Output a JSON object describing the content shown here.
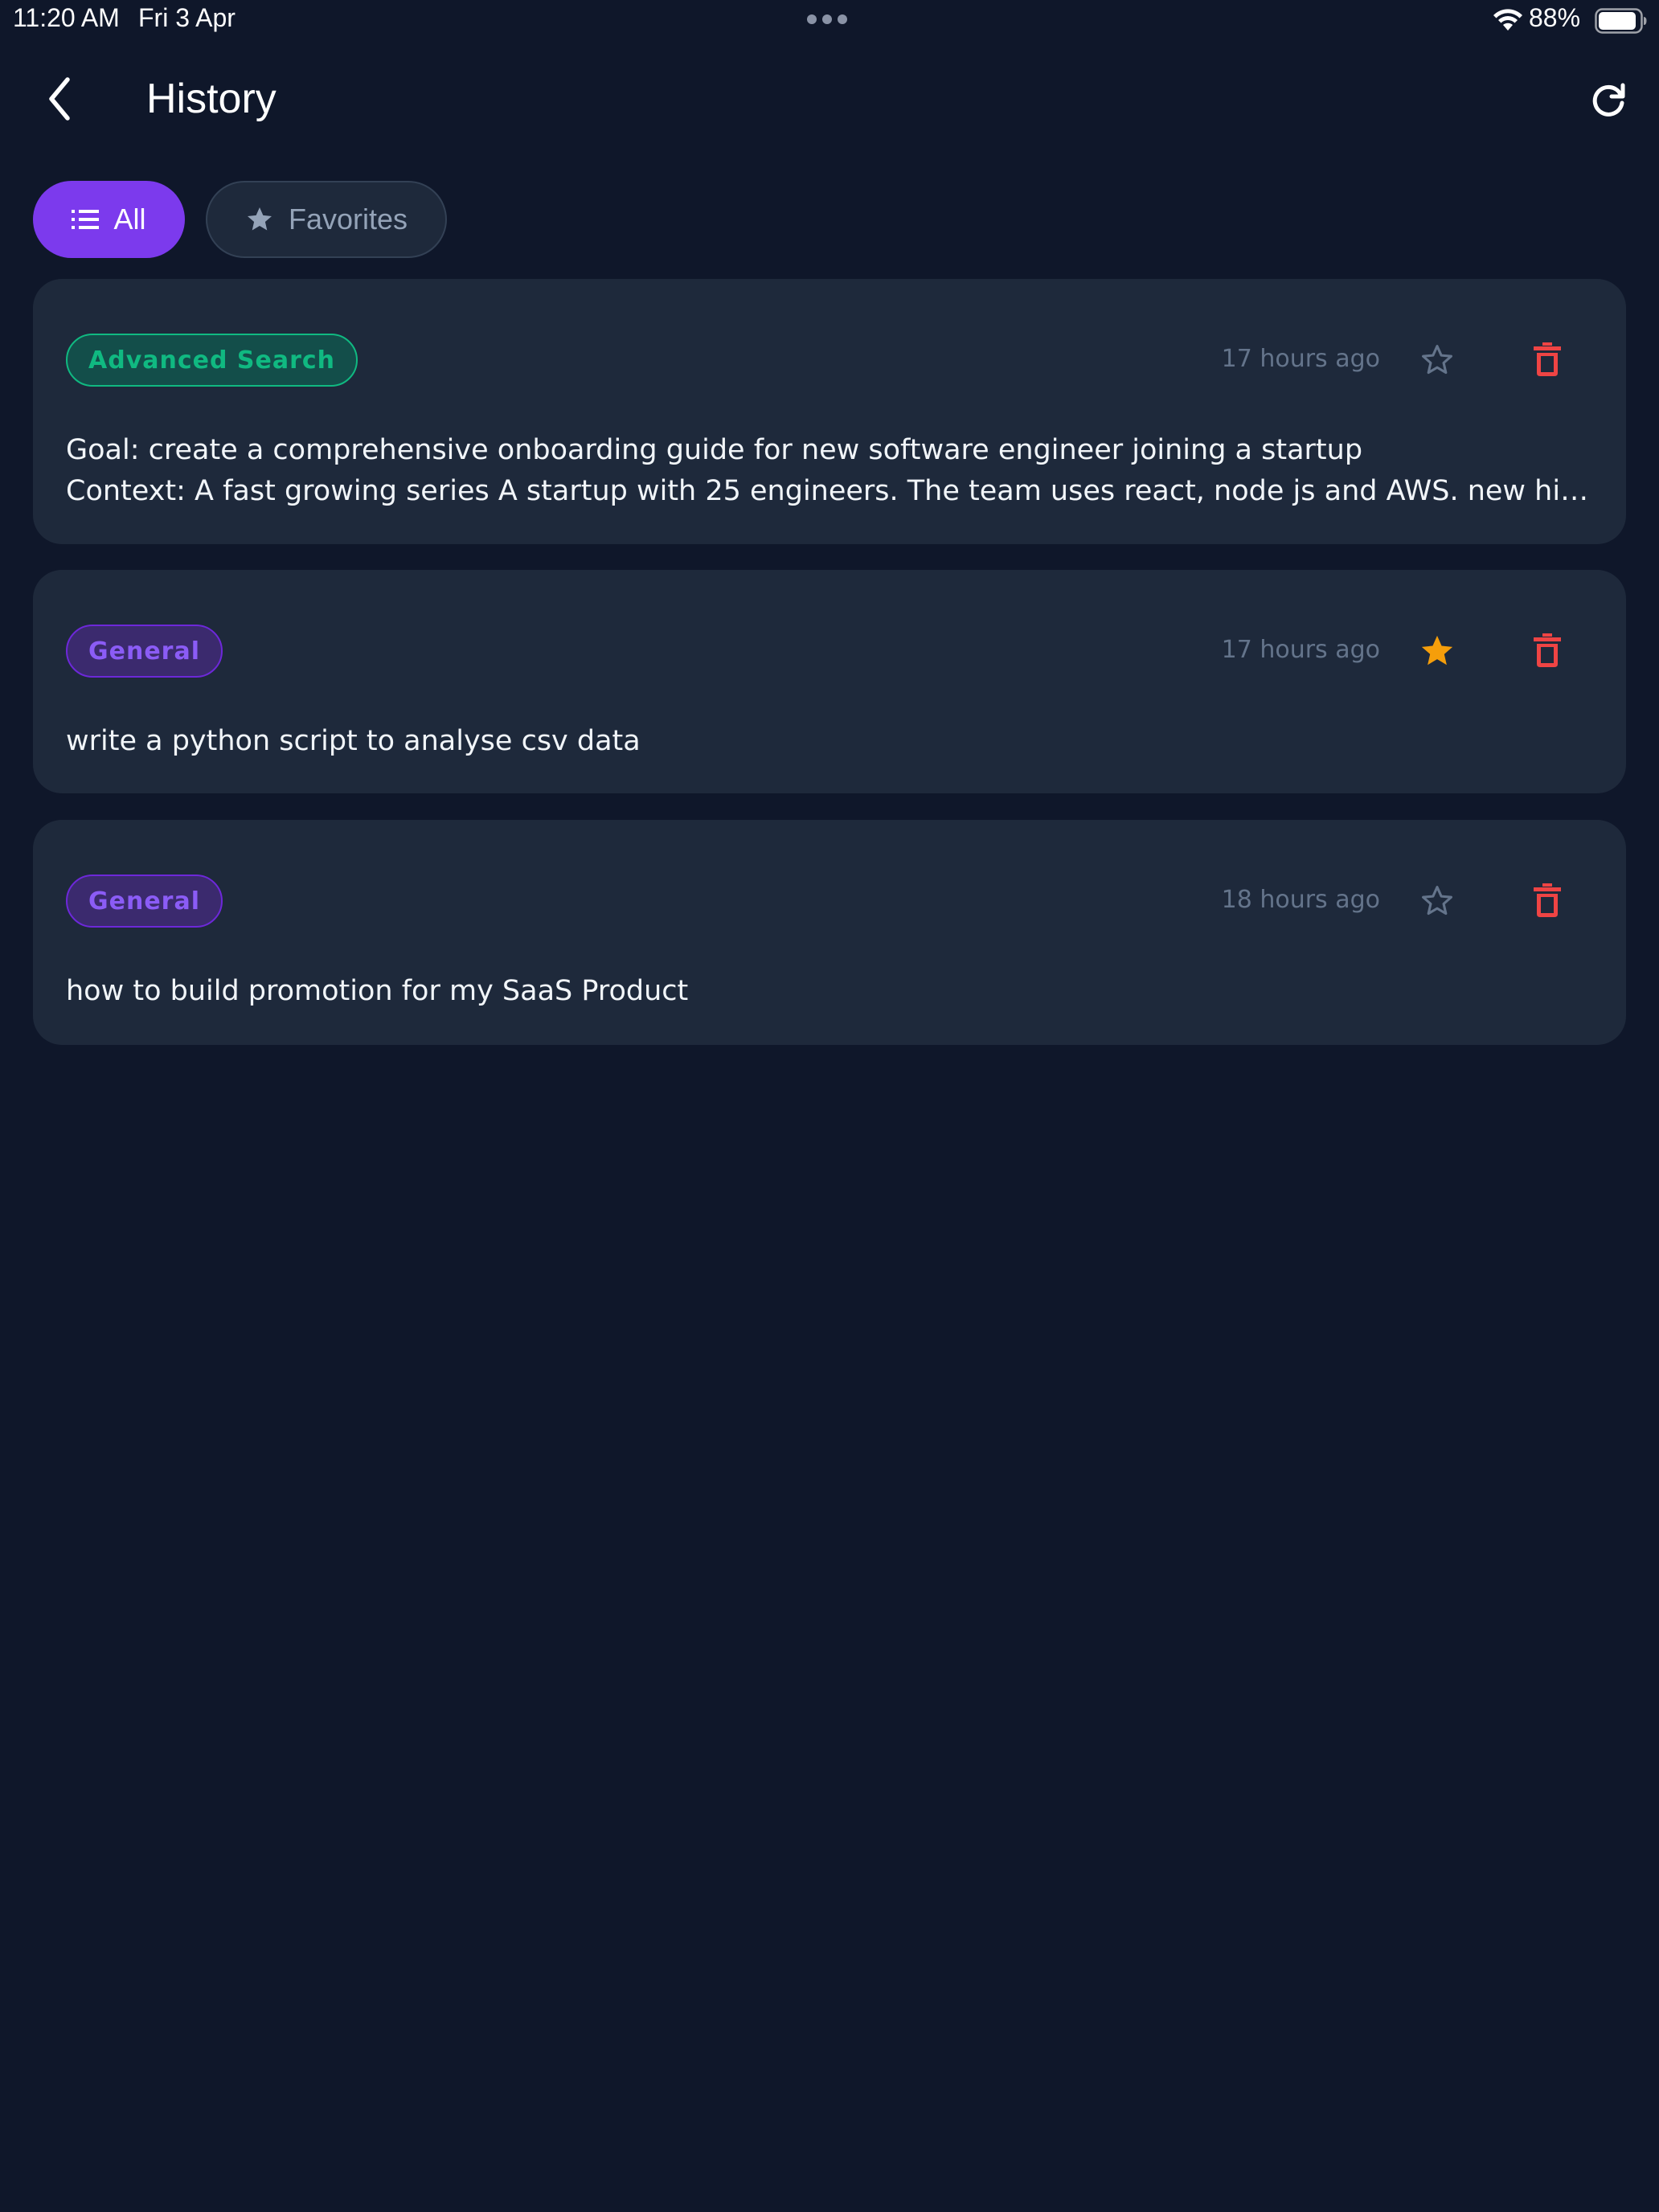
{
  "status_bar": {
    "time": "11:20 AM",
    "date": "Fri 3 Apr",
    "battery": "88%"
  },
  "header": {
    "title": "History",
    "back_icon": "chevron-left-icon",
    "refresh_icon": "refresh-icon"
  },
  "filters": {
    "all": {
      "label": "All",
      "icon": "list-icon",
      "active": true
    },
    "favorites": {
      "label": "Favorites",
      "icon": "star-icon",
      "active": false
    }
  },
  "colors": {
    "background": "#0f172a",
    "card": "#1e293b",
    "accent": "#7c3aed",
    "advanced_badge": "#10b981",
    "general_badge": "#8b5cf6",
    "favorite_star": "#f59e0b",
    "delete": "#ef4444"
  },
  "history": [
    {
      "category": "Advanced Search",
      "time": "17 hours ago",
      "favorite": false,
      "text_line_1": "Goal: create a comprehensive onboarding guide for new software engineer joining a startup",
      "text_line_2": "Context: A fast growing series A startup with 25 engineers. The team uses react, node js and AWS. new hir..."
    },
    {
      "category": "General",
      "time": "17 hours ago",
      "favorite": true,
      "text_line_1": "write a python script to analyse csv data"
    },
    {
      "category": "General",
      "time": "18 hours ago",
      "favorite": false,
      "text_line_1": "how to build promotion for my SaaS Product"
    }
  ]
}
